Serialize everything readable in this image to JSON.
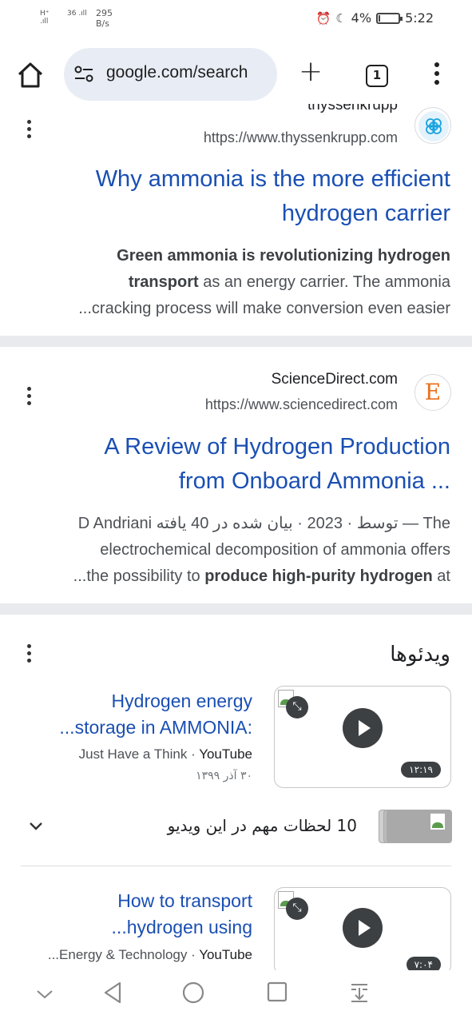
{
  "status": {
    "signal1": "H⁺",
    "signal2": "36",
    "net_speed": "295",
    "net_unit": "B/s",
    "battery": "4%",
    "battery_level": 0.04,
    "time": "5:22"
  },
  "browser": {
    "url": "google.com/search",
    "tab_count": "1"
  },
  "results": [
    {
      "site_name": "thyssenkrupp",
      "url": "https://www.thyssenkrupp.com",
      "title_line1": "Why ammonia is the more efficient",
      "title_line2": "hydrogen carrier",
      "snippet_bold1": "Green ammonia is revolutionizing hydrogen",
      "snippet_bold2": "transport",
      "snippet_rest2": " as an energy carrier. The ammonia",
      "snippet_line3": "...cracking process will make conversion even easier"
    },
    {
      "site_name": "ScienceDirect.com",
      "url": "https://www.sciencedirect.com",
      "favicon_letter": "E",
      "title_line1": "A Review of Hydrogen Production",
      "title_line2": "from Onboard Ammonia ...",
      "snippet_line1": "D Andriani توسط · 2023 · بیان شده در 40 یافته — The",
      "snippet_line2": "electrochemical decomposition of ammonia offers",
      "snippet_line3_pre": "...the possibility to ",
      "snippet_line3_bold": "produce high-purity hydrogen",
      "snippet_line3_post": " at"
    }
  ],
  "videos": {
    "heading": "ویدئوها",
    "items": [
      {
        "title_line1": "Hydrogen energy",
        "title_line2": "...storage in AMMONIA:",
        "channel": "Just Have a Think",
        "platform": "YouTube",
        "date": "۳۰ آذر ۱۳۹۹",
        "duration": "۱۲:۱۹"
      },
      {
        "title_line1": "How to transport",
        "title_line2": "...hydrogen using",
        "channel": "...Energy & Technology",
        "platform": "YouTube",
        "duration": "۷:۰۴"
      }
    ],
    "key_moments": "10 لحظات مهم در این ویدیو"
  }
}
